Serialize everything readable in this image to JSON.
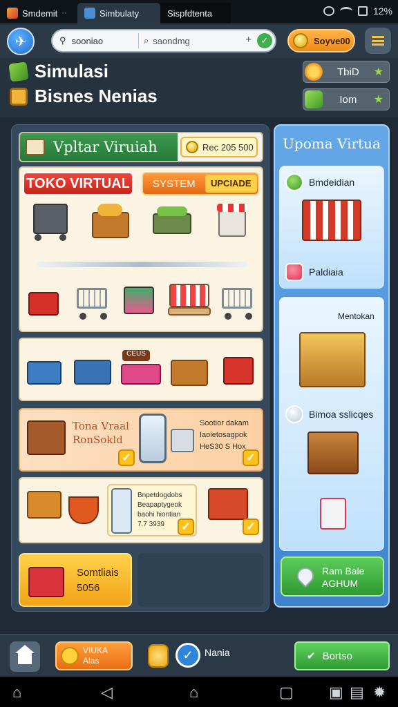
{
  "topbar": {
    "tabs": [
      {
        "label": "Smdemit",
        "close": "··"
      },
      {
        "label": "Simbulaty"
      },
      {
        "label": "Sispfdtenta"
      }
    ],
    "time": "12%"
  },
  "toolbar": {
    "address_left": "sooniao",
    "address_right": "saondmg",
    "plus": "+",
    "coins": "Soyve00"
  },
  "titles": {
    "line1": "Simulasi",
    "line2": "Bisnes Nenias",
    "pill1": "TbiD",
    "pill2": "Iom"
  },
  "main": {
    "header_title": "Vpltar Viruiah",
    "header_price": "Rec 205 500",
    "toko_label": "TOKO VIRTUAL",
    "system_label": "SYSTEM",
    "upgrade_label": "UPCIADE",
    "sign_label": "CEUS",
    "orange_title": "Tona Vraal\nRonSokld",
    "orange_text": "Sootior dakam\nIaoietosagpok\nHeS30 S Hox",
    "p5_text": "Bnpetdogdobs\nBeapaptygeok\nbaohi hiontian\n7.7 3939",
    "side_button": "Somtliais\n5056"
  },
  "side": {
    "title": "Upoma Virtua",
    "row1": "Bmdeidian",
    "row2": "Paldiaia",
    "row3": "Mentokan",
    "row4": "Bimoa sslicqes",
    "button": "Ram Bale\nAGHUM"
  },
  "bottom": {
    "orange_label": "VIUKA\nAlas",
    "mania": "Nania",
    "green_label": "Bortso"
  }
}
